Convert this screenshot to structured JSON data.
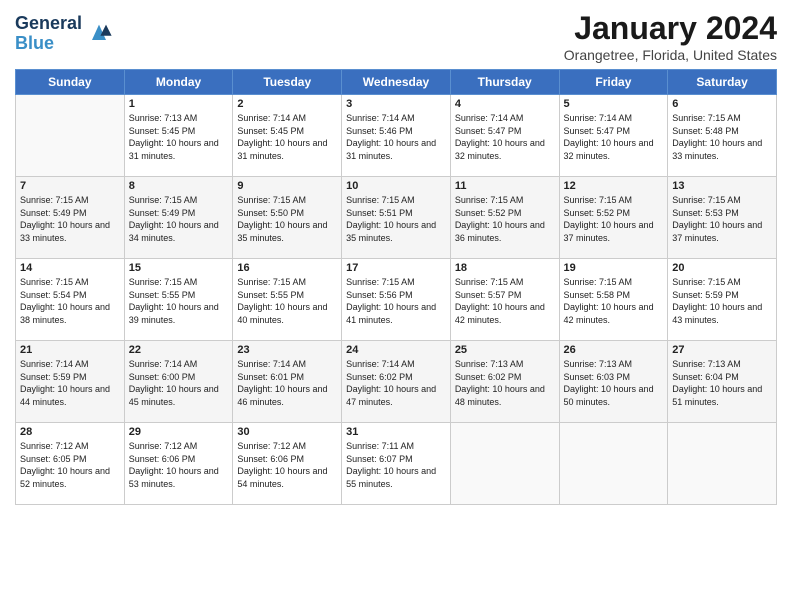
{
  "header": {
    "logo_line1": "General",
    "logo_line2": "Blue",
    "title": "January 2024",
    "location": "Orangetree, Florida, United States"
  },
  "weekdays": [
    "Sunday",
    "Monday",
    "Tuesday",
    "Wednesday",
    "Thursday",
    "Friday",
    "Saturday"
  ],
  "weeks": [
    [
      {
        "day": "",
        "empty": true
      },
      {
        "day": "1",
        "sunrise": "7:13 AM",
        "sunset": "5:45 PM",
        "daylight": "10 hours and 31 minutes."
      },
      {
        "day": "2",
        "sunrise": "7:14 AM",
        "sunset": "5:45 PM",
        "daylight": "10 hours and 31 minutes."
      },
      {
        "day": "3",
        "sunrise": "7:14 AM",
        "sunset": "5:46 PM",
        "daylight": "10 hours and 31 minutes."
      },
      {
        "day": "4",
        "sunrise": "7:14 AM",
        "sunset": "5:47 PM",
        "daylight": "10 hours and 32 minutes."
      },
      {
        "day": "5",
        "sunrise": "7:14 AM",
        "sunset": "5:47 PM",
        "daylight": "10 hours and 32 minutes."
      },
      {
        "day": "6",
        "sunrise": "7:15 AM",
        "sunset": "5:48 PM",
        "daylight": "10 hours and 33 minutes."
      }
    ],
    [
      {
        "day": "7",
        "sunrise": "7:15 AM",
        "sunset": "5:49 PM",
        "daylight": "10 hours and 33 minutes."
      },
      {
        "day": "8",
        "sunrise": "7:15 AM",
        "sunset": "5:49 PM",
        "daylight": "10 hours and 34 minutes."
      },
      {
        "day": "9",
        "sunrise": "7:15 AM",
        "sunset": "5:50 PM",
        "daylight": "10 hours and 35 minutes."
      },
      {
        "day": "10",
        "sunrise": "7:15 AM",
        "sunset": "5:51 PM",
        "daylight": "10 hours and 35 minutes."
      },
      {
        "day": "11",
        "sunrise": "7:15 AM",
        "sunset": "5:52 PM",
        "daylight": "10 hours and 36 minutes."
      },
      {
        "day": "12",
        "sunrise": "7:15 AM",
        "sunset": "5:52 PM",
        "daylight": "10 hours and 37 minutes."
      },
      {
        "day": "13",
        "sunrise": "7:15 AM",
        "sunset": "5:53 PM",
        "daylight": "10 hours and 37 minutes."
      }
    ],
    [
      {
        "day": "14",
        "sunrise": "7:15 AM",
        "sunset": "5:54 PM",
        "daylight": "10 hours and 38 minutes."
      },
      {
        "day": "15",
        "sunrise": "7:15 AM",
        "sunset": "5:55 PM",
        "daylight": "10 hours and 39 minutes."
      },
      {
        "day": "16",
        "sunrise": "7:15 AM",
        "sunset": "5:55 PM",
        "daylight": "10 hours and 40 minutes."
      },
      {
        "day": "17",
        "sunrise": "7:15 AM",
        "sunset": "5:56 PM",
        "daylight": "10 hours and 41 minutes."
      },
      {
        "day": "18",
        "sunrise": "7:15 AM",
        "sunset": "5:57 PM",
        "daylight": "10 hours and 42 minutes."
      },
      {
        "day": "19",
        "sunrise": "7:15 AM",
        "sunset": "5:58 PM",
        "daylight": "10 hours and 42 minutes."
      },
      {
        "day": "20",
        "sunrise": "7:15 AM",
        "sunset": "5:59 PM",
        "daylight": "10 hours and 43 minutes."
      }
    ],
    [
      {
        "day": "21",
        "sunrise": "7:14 AM",
        "sunset": "5:59 PM",
        "daylight": "10 hours and 44 minutes."
      },
      {
        "day": "22",
        "sunrise": "7:14 AM",
        "sunset": "6:00 PM",
        "daylight": "10 hours and 45 minutes."
      },
      {
        "day": "23",
        "sunrise": "7:14 AM",
        "sunset": "6:01 PM",
        "daylight": "10 hours and 46 minutes."
      },
      {
        "day": "24",
        "sunrise": "7:14 AM",
        "sunset": "6:02 PM",
        "daylight": "10 hours and 47 minutes."
      },
      {
        "day": "25",
        "sunrise": "7:13 AM",
        "sunset": "6:02 PM",
        "daylight": "10 hours and 48 minutes."
      },
      {
        "day": "26",
        "sunrise": "7:13 AM",
        "sunset": "6:03 PM",
        "daylight": "10 hours and 50 minutes."
      },
      {
        "day": "27",
        "sunrise": "7:13 AM",
        "sunset": "6:04 PM",
        "daylight": "10 hours and 51 minutes."
      }
    ],
    [
      {
        "day": "28",
        "sunrise": "7:12 AM",
        "sunset": "6:05 PM",
        "daylight": "10 hours and 52 minutes."
      },
      {
        "day": "29",
        "sunrise": "7:12 AM",
        "sunset": "6:06 PM",
        "daylight": "10 hours and 53 minutes."
      },
      {
        "day": "30",
        "sunrise": "7:12 AM",
        "sunset": "6:06 PM",
        "daylight": "10 hours and 54 minutes."
      },
      {
        "day": "31",
        "sunrise": "7:11 AM",
        "sunset": "6:07 PM",
        "daylight": "10 hours and 55 minutes."
      },
      {
        "day": "",
        "empty": true
      },
      {
        "day": "",
        "empty": true
      },
      {
        "day": "",
        "empty": true
      }
    ]
  ]
}
